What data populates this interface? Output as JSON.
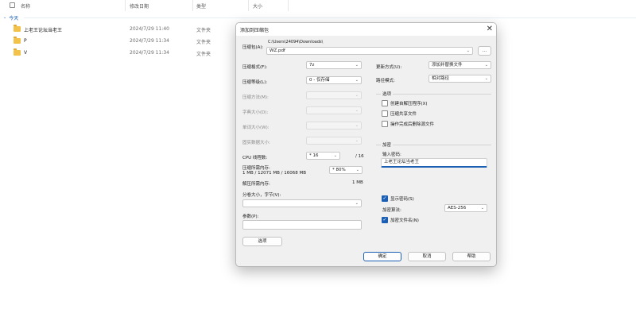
{
  "explorer": {
    "columns": {
      "name": "名称",
      "date": "修改日期",
      "type": "类型",
      "size": "大小"
    },
    "group": "今天",
    "group_chevron": "chevron-down-icon",
    "rows": [
      {
        "name": "上老王论坛当老王",
        "date": "2024/7/29 11:40",
        "type": "文件夹",
        "icon": "folder-icon"
      },
      {
        "name": "P",
        "date": "2024/7/29 11:34",
        "type": "文件夹",
        "icon": "folder-icon"
      },
      {
        "name": "V",
        "date": "2024/7/29 11:34",
        "type": "文件夹",
        "icon": "folder-icon"
      }
    ]
  },
  "dialog": {
    "title": "添加到压缩包",
    "close": "✕",
    "archive_label": "压缩包(A):",
    "archive_path": "C:\\Users\\24094\\Downloads\\",
    "archive_name": "WZ.pdf",
    "browse": "...",
    "left": {
      "format_label": "压缩格式(F):",
      "format_value": "7z",
      "level_label": "压缩等级(L):",
      "level_value": "0 - 仅存储",
      "method_label": "压缩方法(M):",
      "dict_label": "字典大小(D):",
      "word_label": "单词大小(W):",
      "solid_label": "固实数据大小:",
      "cpu_label": "CPU 线程数:",
      "cpu_value": "* 16",
      "cpu_max": "/ 16",
      "mem_label": "压缩所需内存:",
      "mem_detail": "1 MB / 12071 MB / 16068 MB",
      "mem_value": "* 80%",
      "decomp_label": "解压所需内存:",
      "decomp_value": "1 MB",
      "split_label": "分卷大小，字节(V):",
      "params_label": "参数(P):",
      "options_button": "选项"
    },
    "right": {
      "update_label": "更新方式(U):",
      "update_value": "添加并替换文件",
      "path_label": "路径模式:",
      "path_value": "相对路径",
      "options_group": "选项",
      "opt_sfx": "创建自解压程序(X)",
      "opt_shared": "压缩共享文件",
      "opt_delete": "操作完成后删除源文件",
      "encrypt_group": "加密",
      "pwd_label": "输入密码:",
      "pwd_value": "上老王论坛当老王",
      "show_pwd": "显示密码(S)",
      "enc_method_label": "加密算法:",
      "enc_method_value": "AES-256",
      "encrypt_names": "加密文件名(N)"
    },
    "buttons": {
      "ok": "确定",
      "cancel": "取消",
      "help": "帮助"
    }
  },
  "colors": {
    "accent": "#1a5fb4",
    "folder": "#f3c24a"
  }
}
